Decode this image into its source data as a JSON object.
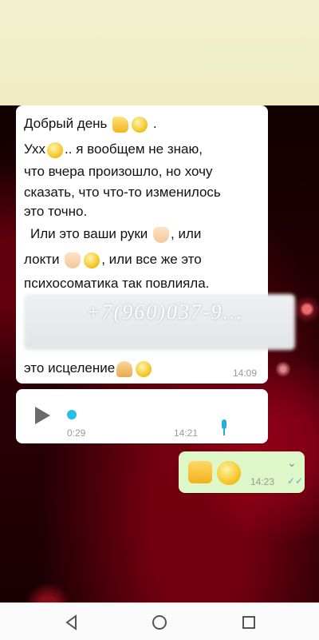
{
  "chat": {
    "message1": {
      "lines": [
        "Добрый день",
        "Ухх",
        ".. я вообщем не знаю,",
        "что вчера произошло, но хочу",
        "сказать, что что-то изменилось",
        "это точно.",
        "Или это ваши руки",
        ", или",
        "локти",
        ", или все же это",
        "психосоматика так повлияла.",
        "это исцеление"
      ],
      "period": ".",
      "time": "14:09",
      "watermark": "+7(960)037-9..."
    },
    "voice_message": {
      "duration": "0:29",
      "time": "14:21"
    },
    "outgoing_message": {
      "time": "14:23"
    }
  },
  "icons": {
    "emojis": [
      "victory-hand",
      "smiling-face",
      "thinking-face",
      "open-hands",
      "flexed-biceps",
      "grinning-face",
      "folded-hands",
      "relieved-face",
      "thumbs-up"
    ],
    "nav": [
      "back-icon",
      "home-icon",
      "recent-apps-icon"
    ]
  },
  "colors": {
    "outgoing_bubble": "#ddf7c8",
    "incoming_bubble": "#ffffff",
    "voice_accent": "#25c0e6",
    "read_ticks": "#52a9e0"
  }
}
